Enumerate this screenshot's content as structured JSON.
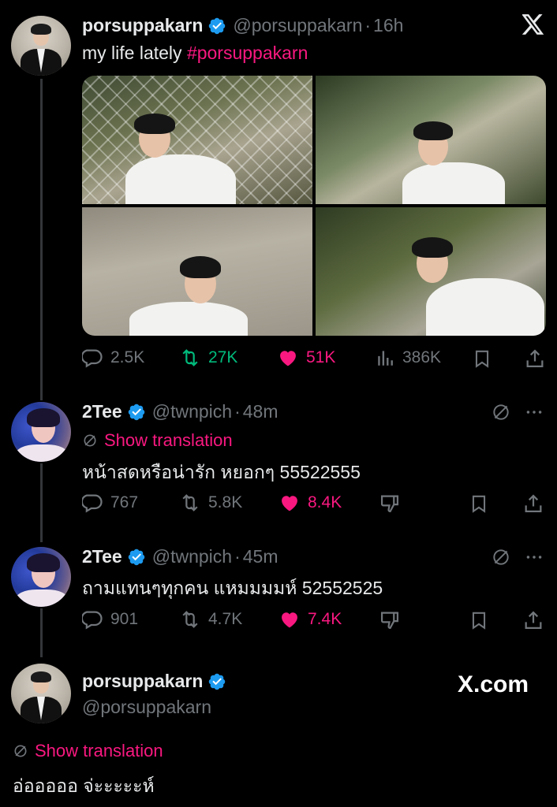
{
  "main_tweet": {
    "name": "porsuppakarn",
    "handle": "@porsuppakarn",
    "dot": "·",
    "time": "16h",
    "text": "my life lately",
    "hashtag": "#porsuppakarn",
    "stats": {
      "replies": "2.5K",
      "retweets": "27K",
      "likes": "51K",
      "views": "386K"
    }
  },
  "replies": [
    {
      "name": "2Tee",
      "handle": "@twnpich",
      "dot": "·",
      "time": "48m",
      "translation_label": "Show translation",
      "text": "หน้าสดหรือน่ารัก หยอกๆ 55522555",
      "stats": {
        "replies": "767",
        "retweets": "5.8K",
        "likes": "8.4K"
      }
    },
    {
      "name": "2Tee",
      "handle": "@twnpich",
      "dot": "·",
      "time": "45m",
      "text": "ถามแทนๆทุกคน แหมมมมห์ 52552525",
      "stats": {
        "replies": "901",
        "retweets": "4.7K",
        "likes": "7.4K"
      }
    }
  ],
  "final_reply": {
    "name": "porsuppakarn",
    "handle": "@porsuppakarn",
    "translation_label": "Show translation",
    "text": "อ่อออออ จ่ะะะะะห์"
  },
  "watermark": "X.com",
  "colors": {
    "accent_pink": "#f91880",
    "retweet_green": "#00ba7c",
    "verified_blue": "#1d9bf0",
    "muted": "#71767b"
  },
  "icons": [
    "x-logo-icon",
    "verified-icon",
    "reply-icon",
    "retweet-icon",
    "heart-icon",
    "views-icon",
    "bookmark-icon",
    "share-icon",
    "translate-icon",
    "more-icon",
    "dislike-icon"
  ]
}
